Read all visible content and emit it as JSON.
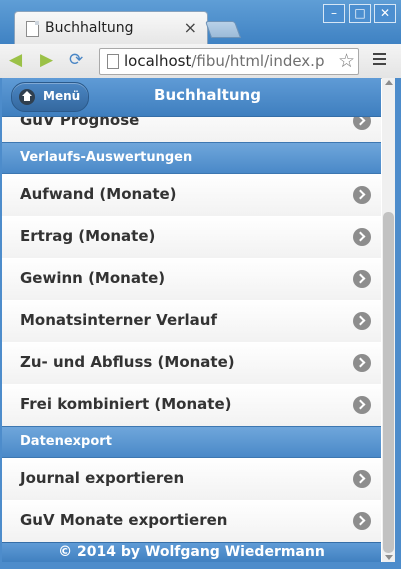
{
  "browser": {
    "tab_title": "Buchhaltung",
    "tab_close": "×",
    "url_host": "localhost",
    "url_path": "/fibu/html/index.p",
    "icons": {
      "back": "arrow-left-icon",
      "forward": "arrow-right-icon",
      "reload": "reload-icon",
      "star": "star-icon",
      "menu": "menu-icon"
    }
  },
  "header": {
    "menu_label": "Menü",
    "title": "Buchhaltung"
  },
  "list": {
    "partial_item": "GuV Prognose",
    "section1": "Verlaufs-Auswertungen",
    "items1": [
      "Aufwand (Monate)",
      "Ertrag (Monate)",
      "Gewinn (Monate)",
      "Monatsinterner Verlauf",
      "Zu- und Abfluss (Monate)",
      "Frei kombiniert (Monate)"
    ],
    "section2": "Datenexport",
    "items2": [
      "Journal exportieren",
      "GuV Monate exportieren"
    ]
  },
  "footer": {
    "text": "© 2014 by Wolfgang Wiedermann"
  },
  "colors": {
    "accent": "#4a89c8",
    "frame": "#4d8ccb"
  }
}
